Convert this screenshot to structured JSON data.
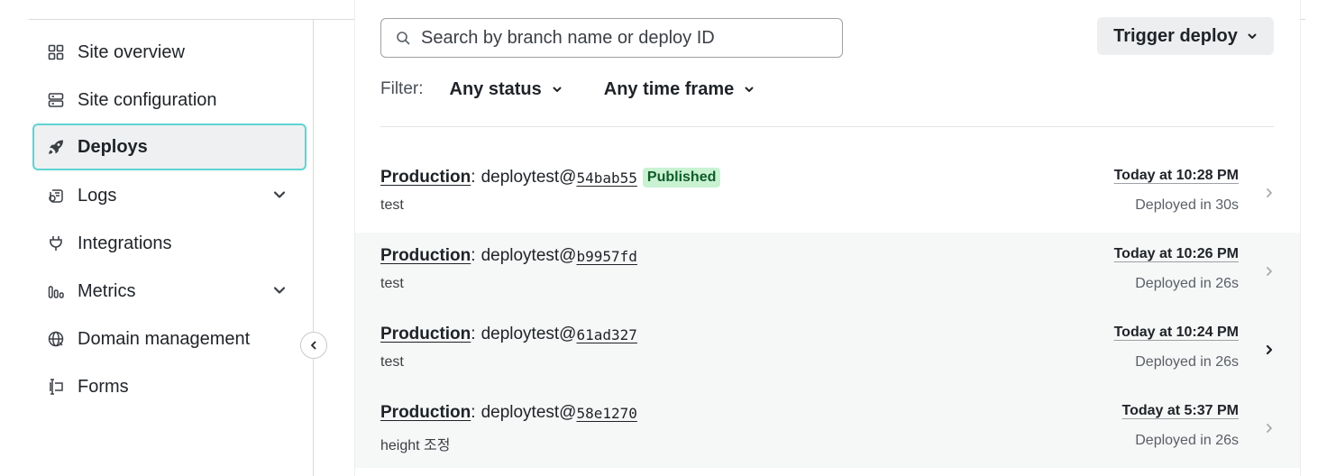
{
  "sidebar": {
    "items": [
      {
        "label": "Site overview",
        "icon": "grid-icon",
        "active": false,
        "has_caret": false
      },
      {
        "label": "Site configuration",
        "icon": "server-icon",
        "active": false,
        "has_caret": false
      },
      {
        "label": "Deploys",
        "icon": "rocket-icon",
        "active": true,
        "has_caret": false
      },
      {
        "label": "Logs",
        "icon": "logs-icon",
        "active": false,
        "has_caret": true
      },
      {
        "label": "Integrations",
        "icon": "plug-icon",
        "active": false,
        "has_caret": false
      },
      {
        "label": "Metrics",
        "icon": "bar-chart-icon",
        "active": false,
        "has_caret": true
      },
      {
        "label": "Domain management",
        "icon": "globe-icon",
        "active": false,
        "has_caret": false
      },
      {
        "label": "Forms",
        "icon": "form-icon",
        "active": false,
        "has_caret": false
      }
    ],
    "collapse_icon": "chevron-left-icon"
  },
  "search": {
    "placeholder": "Search by branch name or deploy ID",
    "value": ""
  },
  "trigger_button": {
    "label": "Trigger deploy"
  },
  "filter": {
    "label": "Filter:",
    "status": "Any status",
    "time_frame": "Any time frame"
  },
  "deploys": [
    {
      "context": "Production",
      "separator": ":",
      "branch": "deploytest@",
      "sha": "54bab55",
      "badge": "Published",
      "message": "test",
      "time": "Today at 10:28 PM",
      "duration": "Deployed in 30s"
    },
    {
      "context": "Production",
      "separator": ":",
      "branch": "deploytest@",
      "sha": "b9957fd",
      "badge": "",
      "message": "test",
      "time": "Today at 10:26 PM",
      "duration": "Deployed in 26s"
    },
    {
      "context": "Production",
      "separator": ":",
      "branch": "deploytest@",
      "sha": "61ad327",
      "badge": "",
      "message": "test",
      "time": "Today at 10:24 PM",
      "duration": "Deployed in 26s"
    },
    {
      "context": "Production",
      "separator": ":",
      "branch": "deploytest@",
      "sha": "58e1270",
      "badge": "",
      "message": "height 조정",
      "time": "Today at 5:37 PM",
      "duration": "Deployed in 26s"
    }
  ],
  "colors": {
    "active_border": "#5fd3d3",
    "published_badge_bg": "#c9f2d2",
    "published_badge_text": "#0f5c2a"
  }
}
